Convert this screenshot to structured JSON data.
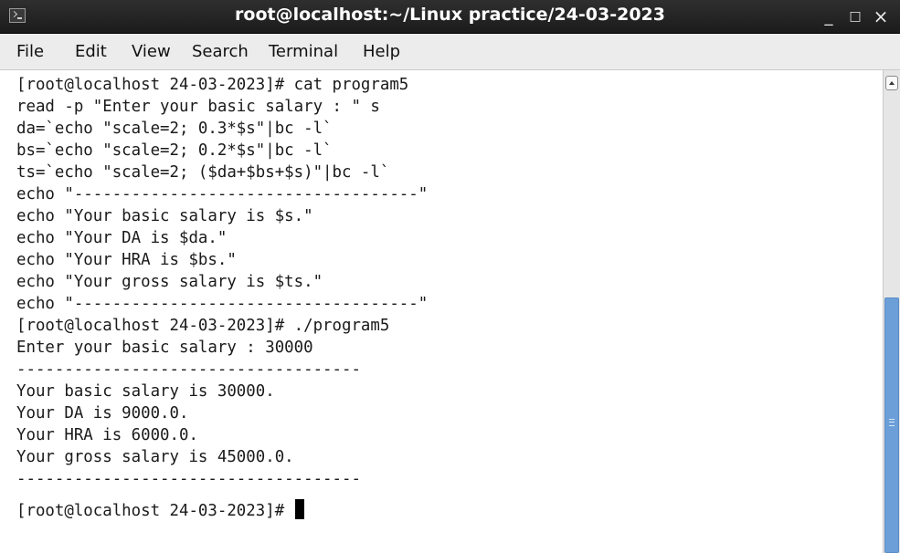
{
  "window": {
    "title": "root@localhost:~/Linux practice/24-03-2023",
    "minimize": "_",
    "maximize": "□",
    "close": "×",
    "icon": "terminal-icon"
  },
  "menu": [
    "File",
    "Edit",
    "View",
    "Search",
    "Terminal",
    "Help"
  ],
  "terminal": {
    "lines": [
      "[root@localhost 24-03-2023]# cat program5",
      "read -p \"Enter your basic salary : \" s",
      "da=`echo \"scale=2; 0.3*$s\"|bc -l`",
      "bs=`echo \"scale=2; 0.2*$s\"|bc -l`",
      "ts=`echo \"scale=2; ($da+$bs+$s)\"|bc -l`",
      "echo \"------------------------------------\"",
      "echo \"Your basic salary is $s.\"",
      "echo \"Your DA is $da.\"",
      "echo \"Your HRA is $bs.\"",
      "echo \"Your gross salary is $ts.\"",
      "echo \"------------------------------------\"",
      "[root@localhost 24-03-2023]# ./program5",
      "Enter your basic salary : 30000",
      "------------------------------------",
      "Your basic salary is 30000.",
      "Your DA is 9000.0.",
      "Your HRA is 6000.0.",
      "Your gross salary is 45000.0.",
      "------------------------------------",
      "[root@localhost 24-03-2023]# "
    ]
  },
  "colors": {
    "titlebar": "#1b1b1b",
    "menubar": "#ececec",
    "scroll_thumb": "#6c9fd8"
  }
}
